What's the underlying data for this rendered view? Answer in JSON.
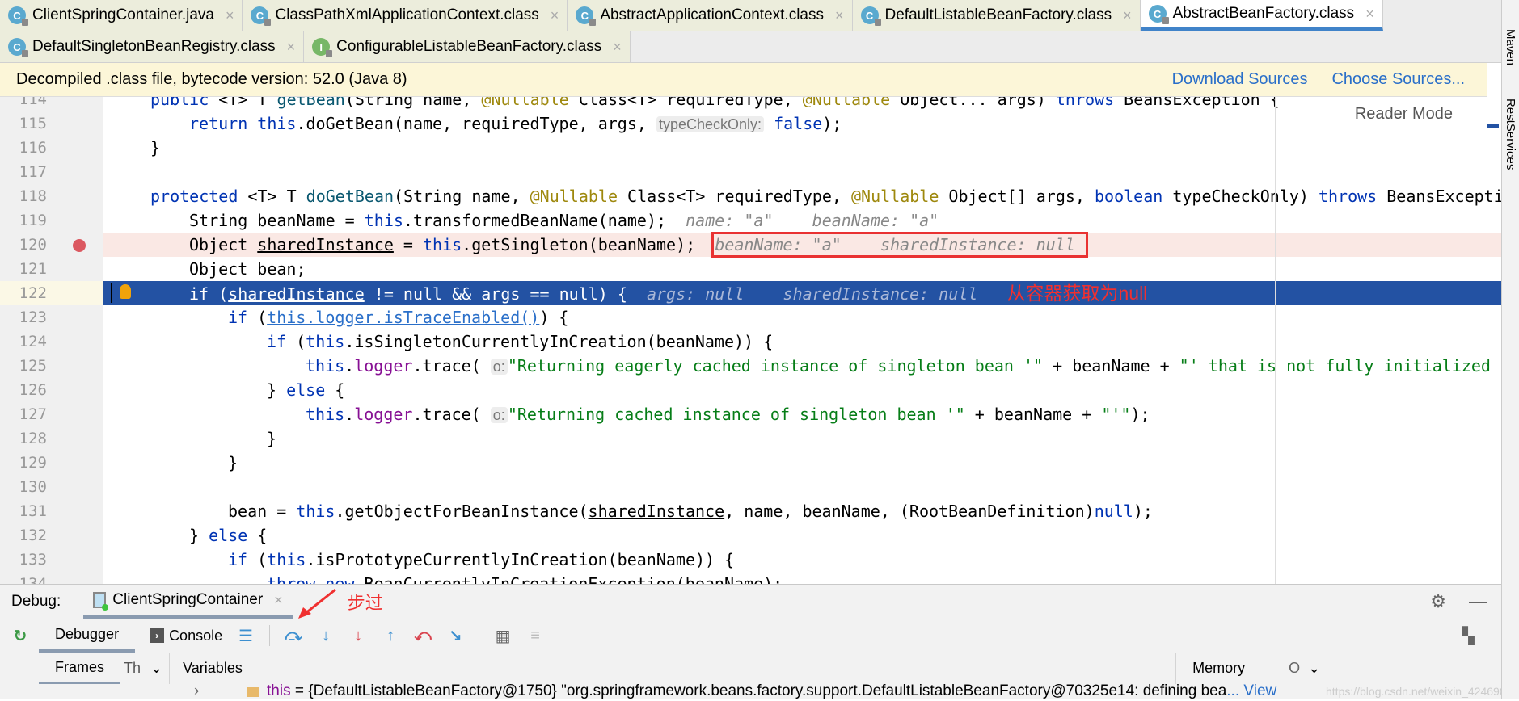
{
  "tabs_row1": [
    {
      "label": "ClientSpringContainer.java",
      "icon": "c"
    },
    {
      "label": "ClassPathXmlApplicationContext.class",
      "icon": "c"
    },
    {
      "label": "AbstractApplicationContext.class",
      "icon": "c"
    },
    {
      "label": "DefaultListableBeanFactory.class",
      "icon": "c"
    },
    {
      "label": "AbstractBeanFactory.class",
      "icon": "c",
      "active": true
    }
  ],
  "tabs_row2": [
    {
      "label": "DefaultSingletonBeanRegistry.class",
      "icon": "c"
    },
    {
      "label": "ConfigurableListableBeanFactory.class",
      "icon": "i"
    }
  ],
  "close_glyph": "×",
  "banner": {
    "text": "Decompiled .class file, bytecode version: 52.0 (Java 8)",
    "download": "Download Sources",
    "choose": "Choose Sources..."
  },
  "reader_mode": "Reader Mode",
  "right_sidebar": [
    "Maven",
    "RestServices"
  ],
  "code": [
    {
      "n": "114",
      "i": 0,
      "t": [
        [
          "k",
          "public "
        ],
        [
          "",
          "<T> T "
        ],
        [
          "m",
          "getBean"
        ],
        [
          "",
          "(String name, "
        ],
        [
          "an",
          "@Nullable"
        ],
        [
          "",
          " Class<T> requiredType, "
        ],
        [
          "an",
          "@Nullable"
        ],
        [
          "",
          " Object... args) "
        ],
        [
          "k",
          "throws"
        ],
        [
          "",
          " BeansException {"
        ]
      ]
    },
    {
      "n": "115",
      "i": 1,
      "t": [
        [
          "k",
          "return this"
        ],
        [
          "",
          ".doGetBean(name, requiredType, args, "
        ],
        [
          "hint",
          "typeCheckOnly:"
        ],
        [
          "k",
          " false"
        ],
        [
          "",
          ");"
        ]
      ]
    },
    {
      "n": "116",
      "i": 0,
      "t": [
        [
          "",
          "}"
        ]
      ]
    },
    {
      "n": "117",
      "i": 0,
      "t": []
    },
    {
      "n": "118",
      "i": 0,
      "t": [
        [
          "k",
          "protected "
        ],
        [
          "",
          "<T> T "
        ],
        [
          "m",
          "doGetBean"
        ],
        [
          "",
          "(String name, "
        ],
        [
          "an",
          "@Nullable"
        ],
        [
          "",
          " Class<T> requiredType, "
        ],
        [
          "an",
          "@Nullable"
        ],
        [
          "",
          " Object[] args, "
        ],
        [
          "k",
          "boolean"
        ],
        [
          "",
          " typeCheckOnly) "
        ],
        [
          "k",
          "throws"
        ],
        [
          "",
          " BeansException {"
        ]
      ]
    },
    {
      "n": "119",
      "i": 1,
      "t": [
        [
          "",
          "String beanName = "
        ],
        [
          "k",
          "this"
        ],
        [
          "",
          ".transformedBeanName(name);  "
        ],
        [
          "iv",
          "name: \"a\"    beanName: \"a\""
        ]
      ]
    },
    {
      "n": "120",
      "i": 1,
      "bp": true,
      "t": [
        [
          "",
          "Object "
        ],
        [
          "u",
          "sharedInstance"
        ],
        [
          "",
          " = "
        ],
        [
          "k",
          "this"
        ],
        [
          "",
          ".getSingleton(beanName);  "
        ],
        [
          "iv box",
          "beanName: \"a\"    sharedInstance: null "
        ]
      ]
    },
    {
      "n": "121",
      "i": 1,
      "t": [
        [
          "",
          "Object bean;"
        ]
      ]
    },
    {
      "n": "122",
      "i": 1,
      "cur": true,
      "t": [
        [
          "",
          "if ("
        ],
        [
          "u",
          "sharedInstance"
        ],
        [
          "",
          " != null && args == null) {  "
        ],
        [
          "iv",
          "args: null    sharedInstance: null   "
        ],
        [
          "note",
          "从容器获取为null"
        ]
      ]
    },
    {
      "n": "123",
      "i": 2,
      "t": [
        [
          "k",
          "if "
        ],
        [
          "",
          "("
        ],
        [
          "lnk",
          "this.logger.isTraceEnabled()"
        ],
        [
          "",
          ") {"
        ]
      ]
    },
    {
      "n": "124",
      "i": 3,
      "t": [
        [
          "k",
          "if "
        ],
        [
          "",
          "("
        ],
        [
          "k",
          "this"
        ],
        [
          "",
          ".isSingletonCurrentlyInCreation(beanName)) {"
        ]
      ]
    },
    {
      "n": "125",
      "i": 4,
      "t": [
        [
          "k",
          "this"
        ],
        [
          "",
          "."
        ],
        [
          "f",
          "logger"
        ],
        [
          "",
          ".trace( "
        ],
        [
          "hint",
          "o:"
        ],
        [
          "s",
          "\"Returning eagerly cached instance of singleton bean '\""
        ],
        [
          "",
          " + beanName + "
        ],
        [
          "s",
          "\"' that is not fully initialized yet\""
        ]
      ]
    },
    {
      "n": "126",
      "i": 3,
      "t": [
        [
          "",
          "} "
        ],
        [
          "k",
          "else"
        ],
        [
          "",
          " {"
        ]
      ]
    },
    {
      "n": "127",
      "i": 4,
      "t": [
        [
          "k",
          "this"
        ],
        [
          "",
          "."
        ],
        [
          "f",
          "logger"
        ],
        [
          "",
          ".trace( "
        ],
        [
          "hint",
          "o:"
        ],
        [
          "s",
          "\"Returning cached instance of singleton bean '\""
        ],
        [
          "",
          " + beanName + "
        ],
        [
          "s",
          "\"'\""
        ],
        [
          "",
          ");"
        ]
      ]
    },
    {
      "n": "128",
      "i": 3,
      "t": [
        [
          "",
          "}"
        ]
      ]
    },
    {
      "n": "129",
      "i": 2,
      "t": [
        [
          "",
          "}"
        ]
      ]
    },
    {
      "n": "130",
      "i": 0,
      "t": []
    },
    {
      "n": "131",
      "i": 2,
      "t": [
        [
          "",
          "bean = "
        ],
        [
          "k",
          "this"
        ],
        [
          "",
          ".getObjectForBeanInstance("
        ],
        [
          "u",
          "sharedInstance"
        ],
        [
          "",
          ", name, beanName, (RootBeanDefinition)"
        ],
        [
          "k",
          "null"
        ],
        [
          "",
          ");"
        ]
      ]
    },
    {
      "n": "132",
      "i": 1,
      "t": [
        [
          "",
          "} "
        ],
        [
          "k",
          "else"
        ],
        [
          "",
          " {"
        ]
      ]
    },
    {
      "n": "133",
      "i": 2,
      "t": [
        [
          "k",
          "if "
        ],
        [
          "",
          "("
        ],
        [
          "k",
          "this"
        ],
        [
          "",
          ".isPrototypeCurrentlyInCreation(beanName)) {"
        ]
      ]
    },
    {
      "n": "134",
      "i": 3,
      "t": [
        [
          "k",
          "throw new "
        ],
        [
          "",
          "BeanCurrentlyInCreationException(beanName);"
        ]
      ]
    }
  ],
  "debug": {
    "label": "Debug:",
    "session": "ClientSpringContainer",
    "annotation": "步过",
    "debugger_tab": "Debugger",
    "console_tab": "Console",
    "frames_tab": "Frames",
    "threads_tab": "Th",
    "variables_label": "Variables",
    "memory_tab": "Memory",
    "overhead_tab": "O",
    "variable_row": {
      "name": "this",
      "value": " = {DefaultListableBeanFactory@1750} \"org.springframework.beans.factory.support.DefaultListableBeanFactory@70325e14: defining bea",
      "view": "... View"
    },
    "watermark": "https://blog.csdn.net/weixin_42469070"
  }
}
